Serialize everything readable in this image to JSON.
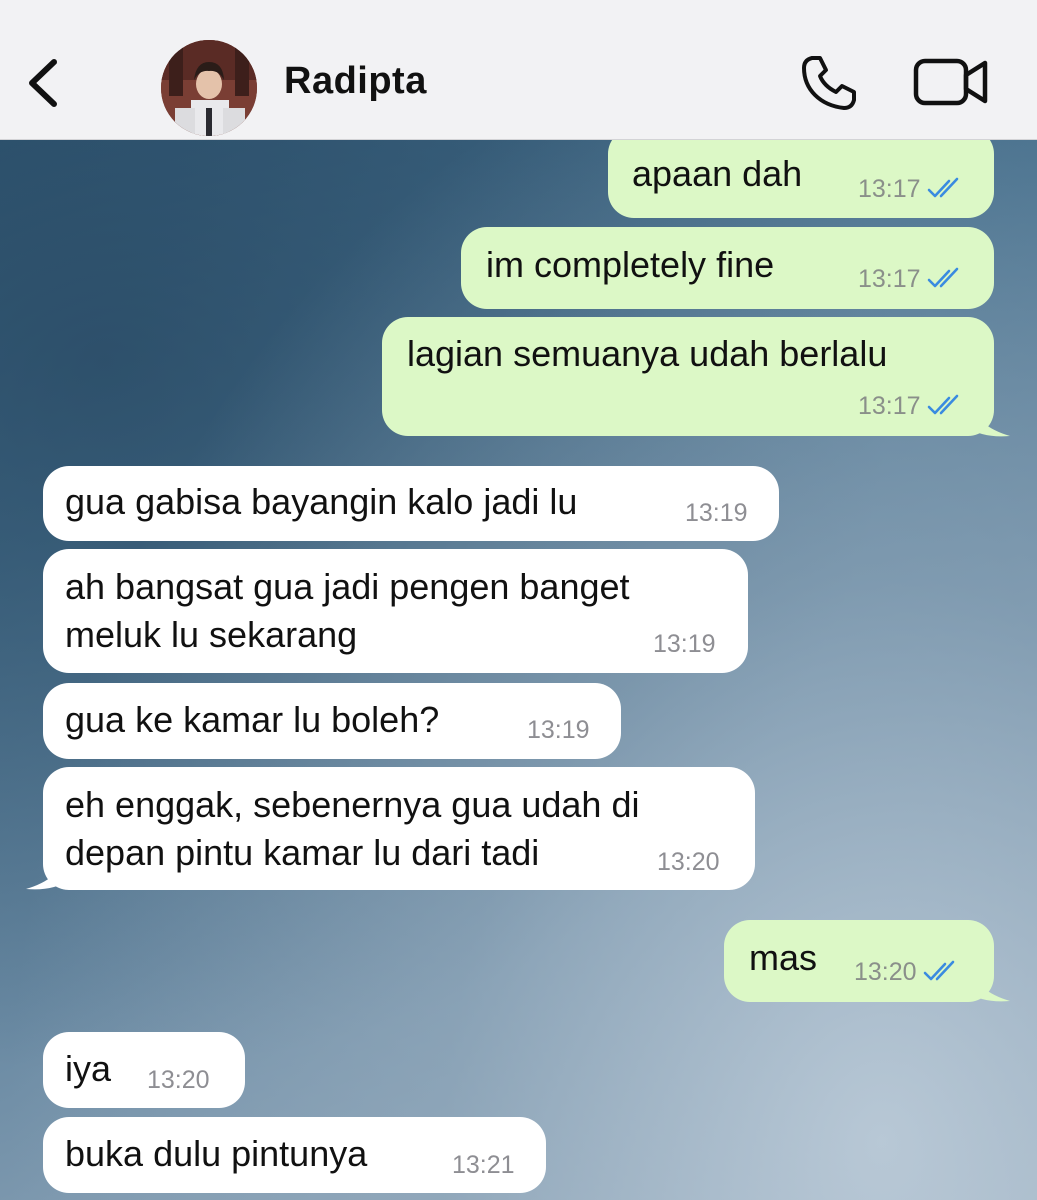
{
  "header": {
    "contact_name": "Radipta",
    "back_icon": "chevron-left-icon",
    "call_icon": "phone-icon",
    "video_icon": "video-camera-icon"
  },
  "colors": {
    "outgoing_bubble": "#dcf8c6",
    "incoming_bubble": "#ffffff",
    "read_ticks": "#3a8be0",
    "header_bg": "#f2f2f4"
  },
  "messages": [
    {
      "direction": "out",
      "text": "apaan dah",
      "time": "13:17",
      "status": "read"
    },
    {
      "direction": "out",
      "text": "im completely fine",
      "time": "13:17",
      "status": "read"
    },
    {
      "direction": "out",
      "text": "lagian semuanya udah berlalu",
      "time": "13:17",
      "status": "read"
    },
    {
      "direction": "in",
      "text": "gua gabisa bayangin kalo jadi lu",
      "time": "13:19"
    },
    {
      "direction": "in",
      "text": "ah bangsat gua jadi pengen banget\nmeluk lu sekarang",
      "time": "13:19"
    },
    {
      "direction": "in",
      "text": "gua ke kamar lu boleh?",
      "time": "13:19"
    },
    {
      "direction": "in",
      "text": "eh enggak, sebenernya gua udah di\ndepan pintu kamar lu dari tadi",
      "time": "13:20"
    },
    {
      "direction": "out",
      "text": "mas",
      "time": "13:20",
      "status": "read"
    },
    {
      "direction": "in",
      "text": "iya",
      "time": "13:20"
    },
    {
      "direction": "in",
      "text": "buka dulu pintunya",
      "time": "13:21"
    }
  ]
}
